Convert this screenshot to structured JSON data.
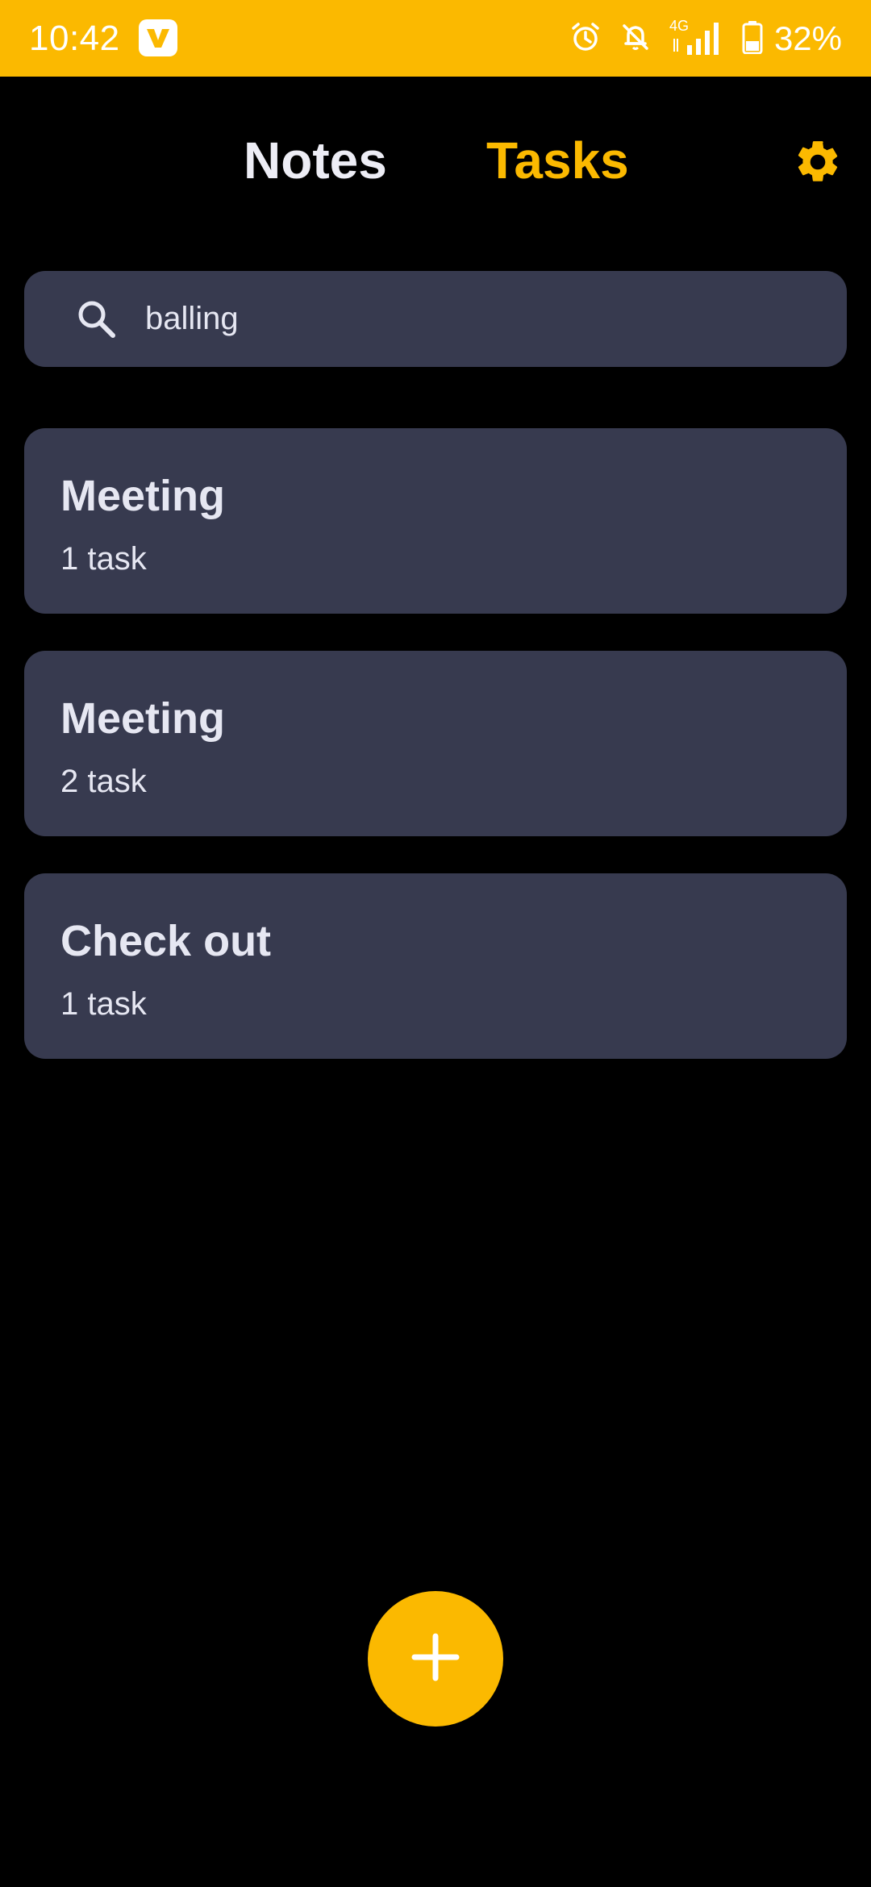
{
  "status_bar": {
    "time": "10:42",
    "app_icon": "v-app-icon",
    "network": "4G",
    "battery_percent": "32%",
    "icons": [
      "alarm-icon",
      "bell-off-icon",
      "network-4g-icon",
      "signal-icon",
      "battery-icon"
    ],
    "color": "#FBB900"
  },
  "header": {
    "tabs": [
      {
        "label": "Notes",
        "active": false
      },
      {
        "label": "Tasks",
        "active": true
      }
    ],
    "settings_icon": "gear-icon"
  },
  "search": {
    "value": "balling",
    "icon": "search-icon"
  },
  "task_lists": [
    {
      "title": "Meeting",
      "count": "1 task"
    },
    {
      "title": "Meeting",
      "count": "2 task"
    },
    {
      "title": "Check out",
      "count": "1 task"
    }
  ],
  "fab": {
    "icon": "plus-icon"
  },
  "colors": {
    "accent": "#FBB900",
    "background": "#000000",
    "card": "#373A4F",
    "text": "#E6E7F2"
  }
}
